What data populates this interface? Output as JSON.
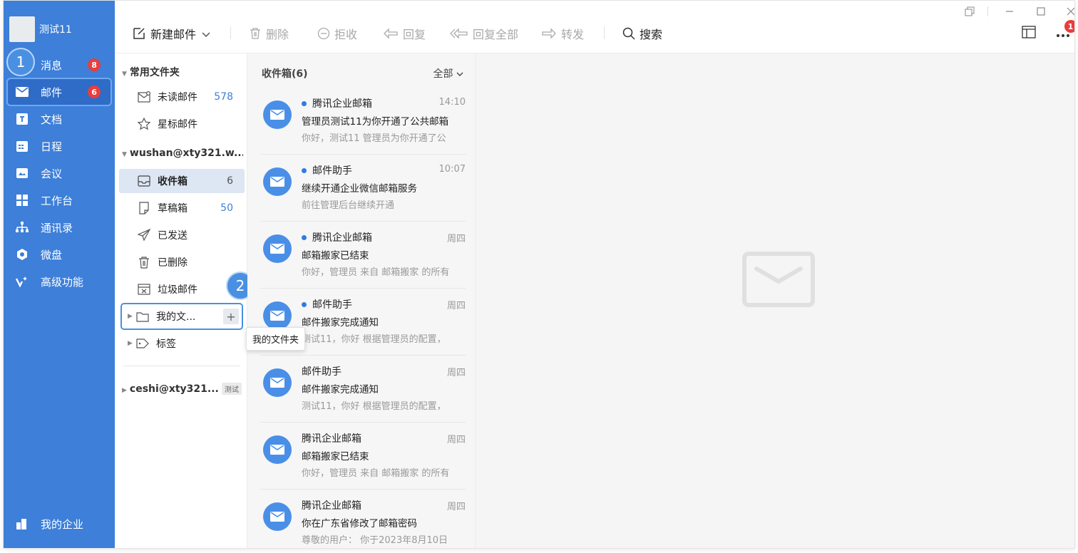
{
  "user": {
    "name": "测试11"
  },
  "rail": {
    "items": [
      {
        "label": "消息",
        "badge": "8",
        "icon": "chat-icon"
      },
      {
        "label": "邮件",
        "badge": "6",
        "icon": "mail-icon"
      },
      {
        "label": "文档",
        "icon": "doc-icon"
      },
      {
        "label": "日程",
        "icon": "calendar-icon"
      },
      {
        "label": "会议",
        "icon": "meeting-icon"
      },
      {
        "label": "工作台",
        "icon": "grid-icon"
      },
      {
        "label": "通讯录",
        "icon": "org-icon"
      },
      {
        "label": "微盘",
        "icon": "drive-icon"
      },
      {
        "label": "高级功能",
        "icon": "sparkle-icon"
      }
    ],
    "footer": "我的企业"
  },
  "steps": {
    "one": "1",
    "two": "2"
  },
  "toolbar": {
    "compose": "新建邮件",
    "delete": "删除",
    "reject": "拒收",
    "reply": "回复",
    "reply_all": "回复全部",
    "forward": "转发",
    "search": "搜索",
    "notif_badge": "1"
  },
  "folders": {
    "common_title": "常用文件夹",
    "unread": {
      "label": "未读邮件",
      "count": "578"
    },
    "starred": {
      "label": "星标邮件"
    },
    "account1": "wushan@xty321.w...",
    "inbox": {
      "label": "收件箱",
      "count": "6"
    },
    "drafts": {
      "label": "草稿箱",
      "count": "50"
    },
    "sent": {
      "label": "已发送"
    },
    "deleted": {
      "label": "已删除"
    },
    "junk": {
      "label": "垃圾邮件"
    },
    "my_folders": {
      "label": "我的文..."
    },
    "tags": {
      "label": "标签"
    },
    "account2": "ceshi@xty321...",
    "account2_tag": "测试",
    "tooltip": "我的文件夹"
  },
  "list": {
    "title": "收件箱(6)",
    "filter": "全部",
    "mails": [
      {
        "from": "腾讯企业邮箱",
        "unread": true,
        "time": "14:10",
        "subject": "管理员测试11为你开通了公共邮箱",
        "preview": "你好，测试11 管理员为你开通了公"
      },
      {
        "from": "邮件助手",
        "unread": true,
        "time": "10:07",
        "subject": "继续开通企业微信邮箱服务",
        "preview": "前往管理后台继续开通"
      },
      {
        "from": "腾讯企业邮箱",
        "unread": true,
        "time": "周四",
        "subject": "邮箱搬家已结束",
        "preview": "你好，管理员 来自 邮箱搬家 的所有"
      },
      {
        "from": "邮件助手",
        "unread": true,
        "time": "周四",
        "subject": "邮件搬家完成通知",
        "preview": "测试11，你好 根据管理员的配置，"
      },
      {
        "from": "邮件助手",
        "unread": false,
        "time": "周四",
        "subject": "邮件搬家完成通知",
        "preview": "测试11，你好 根据管理员的配置，"
      },
      {
        "from": "腾讯企业邮箱",
        "unread": false,
        "time": "周四",
        "subject": "邮箱搬家已结束",
        "preview": "你好，管理员 来自 邮箱搬家 的所有"
      },
      {
        "from": "腾讯企业邮箱",
        "unread": false,
        "time": "周四",
        "subject": "你在广东省修改了邮箱密码",
        "preview": "尊敬的用户： 你于2023年8月10日"
      }
    ]
  },
  "colors": {
    "rail": "#3d7fd9",
    "accent": "#4a90e2",
    "badge": "#e83e3e"
  }
}
